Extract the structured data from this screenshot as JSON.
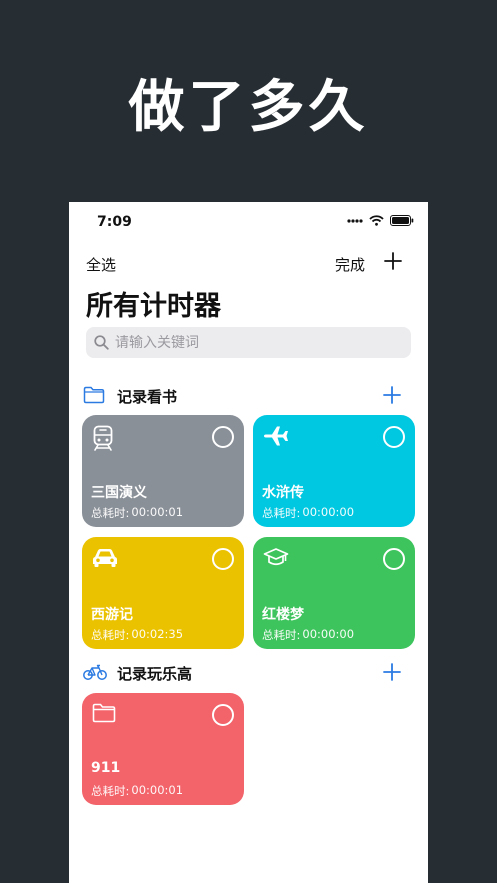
{
  "hero": {
    "title": "做了多久"
  },
  "status": {
    "time": "7:09"
  },
  "nav": {
    "select_all": "全选",
    "done": "完成"
  },
  "page": {
    "title": "所有计时器"
  },
  "search": {
    "placeholder": "请输入关键词"
  },
  "time_prefix": "总耗时:",
  "colors": {
    "accent": "#2a7ae2",
    "gray_card": "#8a9098",
    "cyan_card": "#00c8e0",
    "yellow_card": "#ebc200",
    "green_card": "#3ec45c",
    "red_card": "#f2636a"
  },
  "groups": [
    {
      "title": "记录看书",
      "icon": "folder-icon",
      "timers": [
        {
          "name": "三国演义",
          "time": "00:00:01",
          "icon": "train-icon",
          "color": "#8a9098"
        },
        {
          "name": "水浒传",
          "time": "00:00:00",
          "icon": "airplane-icon",
          "color": "#00c8e0"
        },
        {
          "name": "西游记",
          "time": "00:02:35",
          "icon": "car-icon",
          "color": "#ebc200"
        },
        {
          "name": "红楼梦",
          "time": "00:00:00",
          "icon": "graduation-cap-icon",
          "color": "#3ec45c"
        }
      ]
    },
    {
      "title": "记录玩乐高",
      "icon": "bicycle-icon",
      "timers": [
        {
          "name": "911",
          "time": "00:00:01",
          "icon": "folder-icon",
          "color": "#f2636a"
        }
      ]
    }
  ]
}
